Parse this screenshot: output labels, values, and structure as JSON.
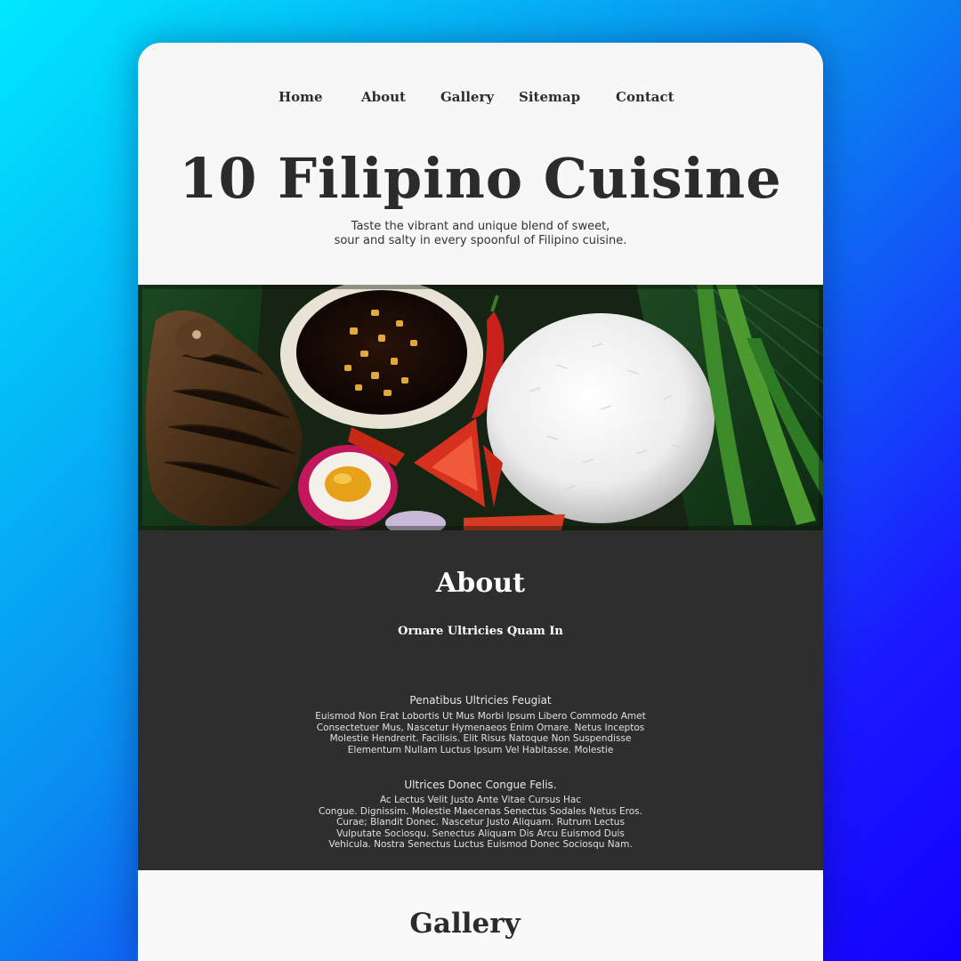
{
  "nav": {
    "items": [
      "Home",
      "About",
      "Gallery",
      "Sitemap",
      "Contact"
    ]
  },
  "hero": {
    "title": "10 Filipino Cuisine",
    "subtitle_line1": "Taste the vibrant and unique blend of sweet,",
    "subtitle_line2": "sour and salty in every spoonful of Filipino cuisine."
  },
  "food_image": {
    "icon": "filipino-food-photo"
  },
  "about": {
    "title": "About",
    "subtitle": "Ornare Ultricies Quam In",
    "blocks": [
      {
        "heading": "Penatibus Ultricies Feugiat",
        "lines": [
          "Euismod Non Erat Lobortis Ut Mus Morbi Ipsum Libero Commodo Amet",
          "Consectetuer Mus, Nascetur Hymenaeos Enim Ornare. Netus Inceptos",
          "Molestie Hendrerit.  Facilisis. Elit Risus Natoque Non Suspendisse",
          "Elementum Nullam Luctus Ipsum Vel Habitasse. Molestie"
        ]
      },
      {
        "heading": "Ultrices Donec Congue Felis.",
        "lines": [
          "Ac Lectus Velit Justo Ante Vitae Cursus Hac",
          "Congue. Dignissim. Molestie Maecenas Senectus Sodales Netus Eros.",
          "Curae; Blandit Donec. Nascetur Justo Aliquam. Rutrum Lectus",
          "Vulputate Sociosqu. Senectus Aliquam Dis Arcu Euismod Duis",
          "Vehicula. Nostra Senectus Luctus Euismod Donec Sociosqu Nam."
        ]
      }
    ]
  },
  "gallery": {
    "title": "Gallery"
  },
  "colors": {
    "card_bg": "#f7f7f7",
    "text_dark": "#2b2b2b",
    "about_bg": "#2e2e2e",
    "gradient_start": "#00e8ff",
    "gradient_end": "#1400ff"
  }
}
